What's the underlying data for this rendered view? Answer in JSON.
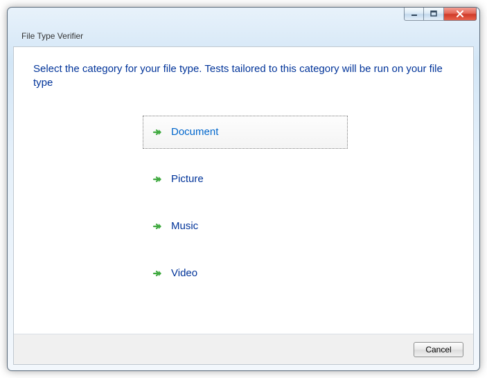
{
  "window": {
    "title": "File Type Verifier"
  },
  "main": {
    "instruction": "Select the category for your file type.  Tests tailored to this category will be run on your file type",
    "options": [
      {
        "label": "Document"
      },
      {
        "label": "Picture"
      },
      {
        "label": "Music"
      },
      {
        "label": "Video"
      }
    ]
  },
  "footer": {
    "cancel_label": "Cancel"
  }
}
